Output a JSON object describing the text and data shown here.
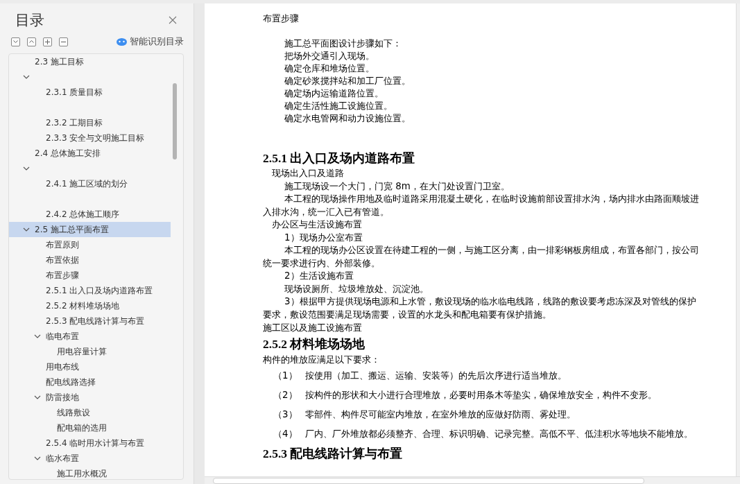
{
  "sidebar": {
    "title": "目录",
    "smart_label": "智能识别目录",
    "toc": [
      {
        "label": "2.3 施工目标",
        "selected": false,
        "expanded": true,
        "caret_row": true,
        "children": [
          {
            "label": "2.3.1 质量目标",
            "selected": false
          },
          {
            "label": "2.3.2 工期目标",
            "selected": false
          },
          {
            "label": "2.3.3 安全与文明施工目标",
            "selected": false
          }
        ]
      },
      {
        "label": "2.4 总体施工安排",
        "selected": false,
        "expanded": true,
        "caret_row": true,
        "children": [
          {
            "label": "2.4.1 施工区域的划分",
            "selected": false
          },
          {
            "label": "2.4.2 总体施工顺序",
            "selected": false
          }
        ]
      },
      {
        "label": "2.5 施工总平面布置",
        "selected": true,
        "expanded": true,
        "caret_row": false,
        "children": [
          {
            "label": "布置原则",
            "selected": false
          },
          {
            "label": "布置依据",
            "selected": false
          },
          {
            "label": "布置步骤",
            "selected": false
          },
          {
            "label": "2.5.1 出入口及场内道路布置",
            "selected": false
          },
          {
            "label": "2.5.2 材料堆场场地",
            "selected": false
          },
          {
            "label": "2.5.3 配电线路计算与布置",
            "selected": false
          },
          {
            "label": "临电布置",
            "selected": false,
            "expanded": true,
            "caret_row": false,
            "children": [
              {
                "label": "用电容量计算",
                "selected": false
              }
            ]
          },
          {
            "label": "用电布线",
            "selected": false
          },
          {
            "label": "配电线路选择",
            "selected": false
          },
          {
            "label": "防雷接地",
            "selected": false,
            "expanded": true,
            "caret_row": false,
            "children": [
              {
                "label": "线路敷设",
                "selected": false
              },
              {
                "label": "配电箱的选用",
                "selected": false
              }
            ]
          },
          {
            "label": "2.5.4 临时用水计算与布置",
            "selected": false
          },
          {
            "label": "临水布置",
            "selected": false,
            "expanded": true,
            "caret_row": false,
            "children": [
              {
                "label": "施工用水概况",
                "selected": false
              }
            ]
          }
        ]
      }
    ]
  },
  "document": {
    "blocks": [
      {
        "kind": "label",
        "text": "布置步骤"
      },
      {
        "kind": "steps",
        "lines": [
          "施工总平面图设计步骤如下：",
          "把场外交通引入现场。",
          "确定仓库和堆场位置。",
          "确定砂浆搅拌站和加工厂位置。",
          "确定场内运输道路位置。",
          "确定生活性施工设施位置。",
          "确定水电管网和动力设施位置。"
        ]
      },
      {
        "kind": "heading",
        "text": "2.5.1 出入口及场内道路布置"
      },
      {
        "kind": "subhead",
        "text": "现场出入口及道路"
      },
      {
        "kind": "para",
        "text": "施工现场设一个大门，门宽 8m，在大门处设置门卫室。"
      },
      {
        "kind": "para",
        "text": "本工程的现场操作用地及临时道路采用混凝土硬化，在临时设施前部设置排水沟，场内排水由路面顺坡进入排水沟，统一汇入已有管道。"
      },
      {
        "kind": "subhead",
        "text": "办公区与生活设施布置"
      },
      {
        "kind": "para",
        "text": "1）现场办公室布置"
      },
      {
        "kind": "para",
        "text": "本工程的现场办公区设置在待建工程的一侧，与施工区分离，由一排彩钢板房组成，布置各部门，按公司统一要求进行内、外部装修。"
      },
      {
        "kind": "para",
        "text": "2）生活设施布置"
      },
      {
        "kind": "para",
        "text": "现场设厕所、垃圾堆放处、沉淀池。"
      },
      {
        "kind": "para",
        "text": "3）根据甲方提供现场电源和上水管，敷设现场的临水临电线路，线路的敷设要考虑冻深及对管线的保护要求，敷设范围要满足现场需要，设置的水龙头和配电箱要有保护措施。"
      },
      {
        "kind": "label",
        "text": "施工区以及施工设施布置"
      },
      {
        "kind": "heading",
        "text": "2.5.2 材料堆场场地"
      },
      {
        "kind": "label",
        "text": "构件的堆放应满足以下要求："
      },
      {
        "kind": "numbered",
        "number": "（1）",
        "text": "按使用（加工、搬运、运输、安装等）的先后次序进行适当堆放。"
      },
      {
        "kind": "numbered",
        "number": "（2）",
        "text": "按构件的形状和大小进行合理堆放，必要时用条木等垫实，确保堆放安全，构件不变形。"
      },
      {
        "kind": "numbered",
        "number": "（3）",
        "text": "零部件、构件尽可能室内堆放，在室外堆放的应做好防雨、雾处理。"
      },
      {
        "kind": "numbered",
        "number": "（4）",
        "text": "厂内、厂外堆放都必须整齐、合理、标识明确、记录完整。高低不平、低洼积水等地块不能堆放。"
      },
      {
        "kind": "heading",
        "text": "2.5.3 配电线路计算与布置"
      }
    ]
  }
}
